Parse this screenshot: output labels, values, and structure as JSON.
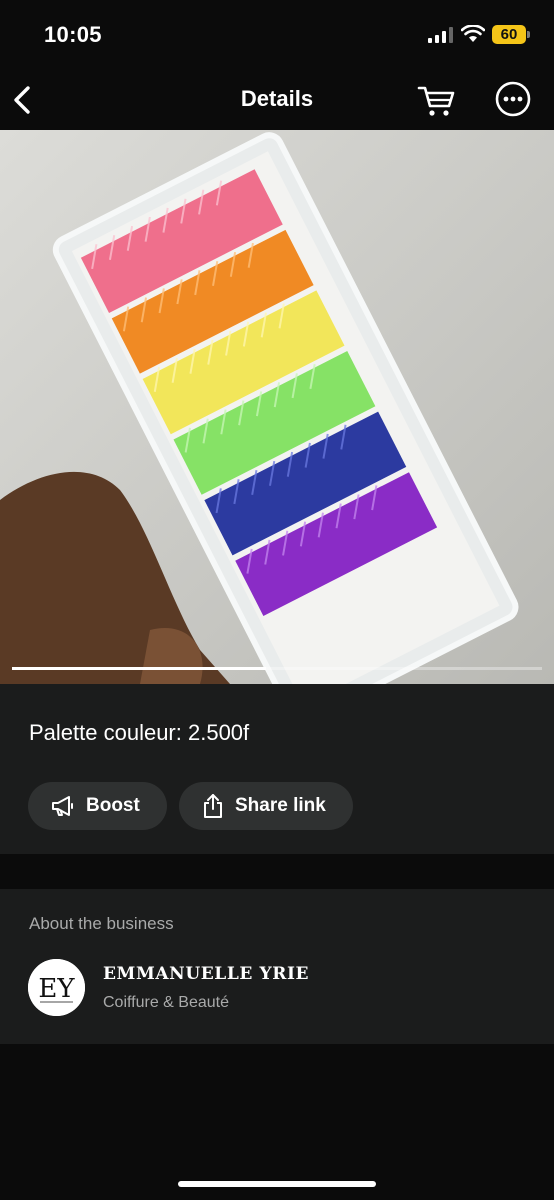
{
  "status_bar": {
    "time": "10:05",
    "battery": "60"
  },
  "nav": {
    "title": "Details",
    "icons": [
      "back-icon",
      "cart-icon",
      "more-icon"
    ]
  },
  "media": {
    "progress_fraction": 0.48
  },
  "product": {
    "title": "Palette couleur: 2.500f",
    "boost_label": "Boost",
    "share_label": "Share link"
  },
  "business": {
    "section_label": "About the business",
    "name": "EMMANUELLE YRIE",
    "category": "Coiffure & Beauté",
    "avatar_initials": "EY"
  },
  "colors": {
    "background": "#0b0b0b",
    "card": "#1b1c1c",
    "chip": "#2f3131",
    "battery": "#f5c518"
  }
}
